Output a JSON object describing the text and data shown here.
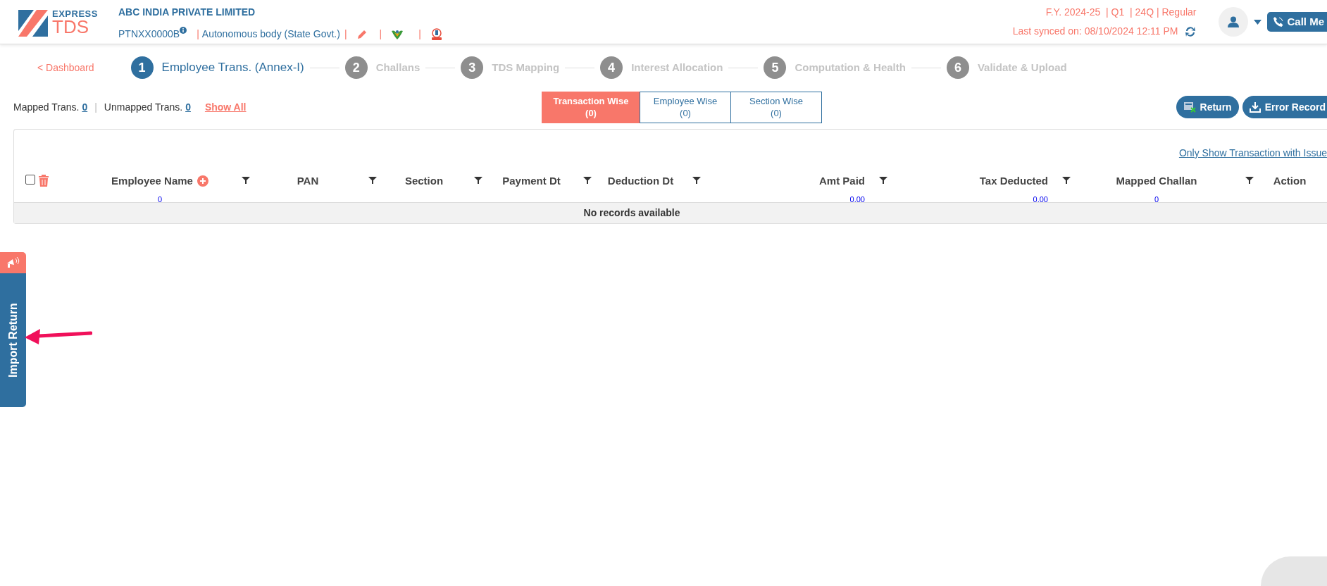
{
  "header": {
    "logo": {
      "top": "EXPRESS",
      "bottom": "TDS"
    },
    "company": "ABC INDIA PRIVATE LIMITED",
    "pan": "PTNXX0000B",
    "deductor_type": "Autonomous body (State Govt.)",
    "separators": [
      "|",
      "|",
      "|",
      "|"
    ],
    "return_info": "F.Y. 2024-25  | Q1  | 24Q | Regular",
    "last_synced": "Last synced on: 08/10/2024 12:11 PM",
    "call_button": "Call Me"
  },
  "back_link": "< Dashboard",
  "steps": [
    {
      "number": "1",
      "label": "Employee Trans. (Annex-I)",
      "selected": true
    },
    {
      "number": "2",
      "label": "Challans",
      "selected": false
    },
    {
      "number": "3",
      "label": "TDS Mapping",
      "selected": false
    },
    {
      "number": "4",
      "label": "Interest Allocation",
      "selected": false
    },
    {
      "number": "5",
      "label": "Computation & Health",
      "selected": false
    },
    {
      "number": "6",
      "label": "Validate & Upload",
      "selected": false
    }
  ],
  "summary": {
    "mapped_label": "Mapped Trans.",
    "mapped_count": "0",
    "separator": "|",
    "unmapped_label": "Unmapped Trans.",
    "unmapped_count": "0",
    "show_all": "Show All"
  },
  "view_tabs": [
    {
      "label": "Transaction Wise",
      "count": "(0)",
      "selected": true
    },
    {
      "label": "Employee Wise",
      "count": "(0)",
      "selected": false
    },
    {
      "label": "Section Wise",
      "count": "(0)",
      "selected": false
    }
  ],
  "actions": [
    {
      "kind": "return",
      "label": "Return"
    },
    {
      "kind": "download",
      "label": "Error Record"
    }
  ],
  "table": {
    "issue_filter_link": "Only Show Transaction with Issue",
    "select_all_checked": false,
    "columns": [
      {
        "label": "Employee Name",
        "add": true,
        "filterable": true,
        "kind": "count",
        "total": "0"
      },
      {
        "label": "PAN",
        "filterable": true,
        "kind": "plain"
      },
      {
        "label": "Section",
        "filterable": true,
        "kind": "plain"
      },
      {
        "label": "Payment Dt",
        "filterable": true,
        "kind": "plain"
      },
      {
        "label": "Deduction Dt",
        "filterable": true,
        "kind": "plain"
      },
      {
        "label": "Amt Paid",
        "filterable": true,
        "kind": "amount",
        "total": "0.00"
      },
      {
        "label": "Tax Deducted",
        "filterable": true,
        "kind": "amount",
        "total": "0.00"
      },
      {
        "label": "Mapped Challan",
        "filterable": true,
        "kind": "count",
        "total": "0"
      },
      {
        "label": "Action",
        "filterable": false,
        "kind": "plain"
      }
    ],
    "empty_message": "No records available"
  },
  "side_tab": {
    "label": "Import Return"
  }
}
